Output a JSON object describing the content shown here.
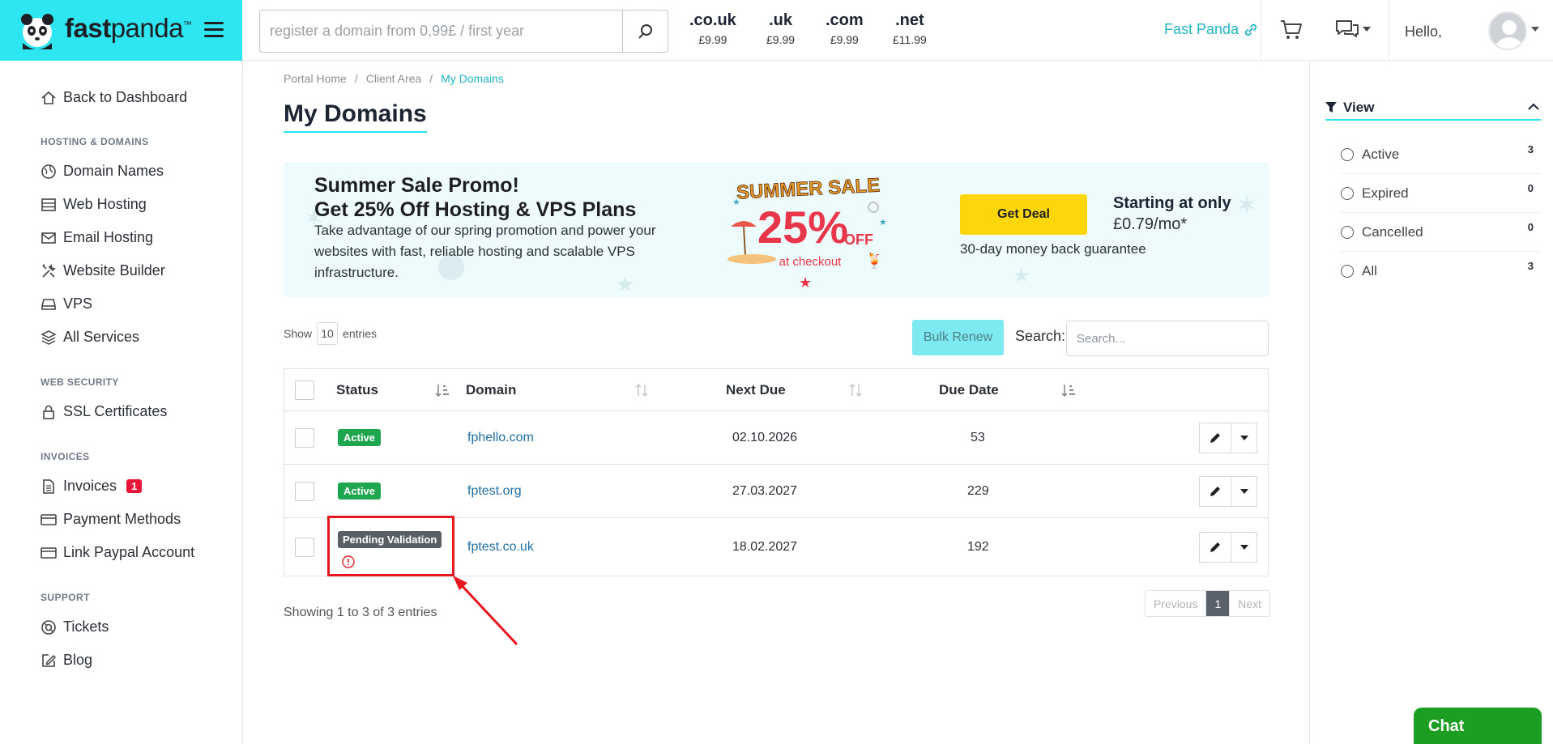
{
  "brand": {
    "name_bold": "fast",
    "name_rest": "panda",
    "tm": "™"
  },
  "topbar": {
    "search_placeholder": "register a domain from 0,99£ / first year",
    "tlds": [
      {
        "name": ".co.uk",
        "price": "£9.99"
      },
      {
        "name": ".uk",
        "price": "£9.99"
      },
      {
        "name": ".com",
        "price": "£9.99"
      },
      {
        "name": ".net",
        "price": "£11.99"
      }
    ],
    "fast_panda_link": "Fast Panda",
    "hello": "Hello,"
  },
  "sidebar": {
    "back": "Back to Dashboard",
    "sections": [
      {
        "heading": "HOSTING & DOMAINS",
        "items": [
          "Domain Names",
          "Web Hosting",
          "Email Hosting",
          "Website Builder",
          "VPS",
          "All Services"
        ]
      },
      {
        "heading": "WEB SECURITY",
        "items": [
          "SSL Certificates"
        ]
      },
      {
        "heading": "INVOICES",
        "items": [
          "Invoices",
          "Payment Methods",
          "Link Paypal Account"
        ]
      },
      {
        "heading": "SUPPORT",
        "items": [
          "Tickets",
          "Blog"
        ]
      }
    ],
    "invoices_badge": "1"
  },
  "breadcrumb": [
    "Portal Home",
    "/",
    "Client Area",
    "/",
    "My Domains"
  ],
  "page_title": "My Domains",
  "promo": {
    "title_line1": "Summer Sale Promo!",
    "title_line2": "Get 25% Off Hosting & VPS Plans",
    "description": "Take advantage of our spring promotion and power your websites with fast, reliable hosting and scalable VPS infrastructure.",
    "art_heading": "SUMMER SALE",
    "art_percent": "25%",
    "art_off": "OFF",
    "art_checkout": "at checkout",
    "cta": "Get Deal",
    "starting_label": "Starting at only",
    "starting_price": "£0.79/mo*",
    "guarantee": "30-day money back guarantee"
  },
  "table_controls": {
    "show": "Show",
    "entries_value": "10",
    "entries": "entries",
    "bulk_renew": "Bulk Renew",
    "search_label": "Search:",
    "search_placeholder": "Search..."
  },
  "table": {
    "headers": [
      "Status",
      "Domain",
      "Next Due",
      "Due Date"
    ],
    "rows": [
      {
        "status": "Active",
        "domain": "fphello.com",
        "next_due": "02.10.2026",
        "due_date": "53"
      },
      {
        "status": "Active",
        "domain": "fptest.org",
        "next_due": "27.03.2027",
        "due_date": "229"
      },
      {
        "status": "Pending Validation",
        "domain": "fptest.co.uk",
        "next_due": "18.02.2027",
        "due_date": "192"
      }
    ]
  },
  "footer": {
    "showing": "Showing 1 to 3 of 3 entries",
    "previous": "Previous",
    "page": "1",
    "next": "Next"
  },
  "view_panel": {
    "title": "View",
    "filters": [
      {
        "label": "Active",
        "count": "3"
      },
      {
        "label": "Expired",
        "count": "0"
      },
      {
        "label": "Cancelled",
        "count": "0"
      },
      {
        "label": "All",
        "count": "3"
      }
    ]
  },
  "chat": "Chat",
  "colors": {
    "brand_cyan": "#2ee6f2",
    "active_green": "#1ea64f",
    "pending_gray": "#5a5f66",
    "cta_yellow": "#ffd60a",
    "annotation_red": "#e8141e",
    "chat_green": "#1b9e22"
  },
  "icons": [
    "panda-logo-icon",
    "hamburger-icon",
    "search-icon",
    "link-icon",
    "cart-icon",
    "chat-bubbles-icon",
    "avatar-icon",
    "home-icon",
    "globe-icon",
    "server-icon",
    "envelope-icon",
    "tools-icon",
    "hdd-icon",
    "layers-icon",
    "lock-icon",
    "file-icon",
    "credit-card-icon",
    "paypal-icon",
    "ticket-icon",
    "edit-icon",
    "filter-icon",
    "pencil-icon",
    "caret-down-icon",
    "alert-circle-icon",
    "sort-icon"
  ]
}
